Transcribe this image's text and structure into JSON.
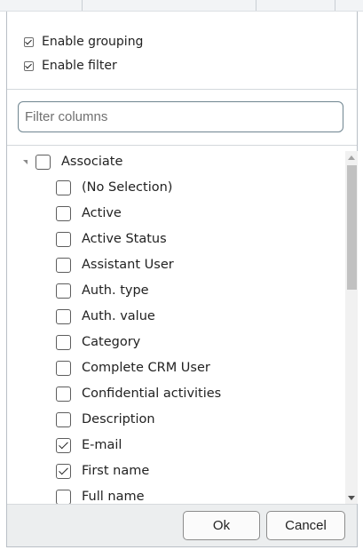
{
  "options": {
    "enable_grouping": {
      "label": "Enable grouping",
      "checked": true
    },
    "enable_filter": {
      "label": "Enable filter",
      "checked": true
    }
  },
  "filter": {
    "placeholder": "Filter columns",
    "value": ""
  },
  "tree": {
    "root": {
      "label": "Associate",
      "checked": false,
      "expanded": true
    },
    "items": [
      {
        "label": "(No Selection)",
        "checked": false
      },
      {
        "label": "Active",
        "checked": false
      },
      {
        "label": "Active Status",
        "checked": false
      },
      {
        "label": "Assistant User",
        "checked": false
      },
      {
        "label": "Auth. type",
        "checked": false
      },
      {
        "label": "Auth. value",
        "checked": false
      },
      {
        "label": "Category",
        "checked": false
      },
      {
        "label": "Complete CRM User",
        "checked": false
      },
      {
        "label": "Confidential activities",
        "checked": false
      },
      {
        "label": "Description",
        "checked": false
      },
      {
        "label": "E-mail",
        "checked": true
      },
      {
        "label": "First name",
        "checked": true
      },
      {
        "label": "Full name",
        "checked": false
      }
    ]
  },
  "footer": {
    "ok_label": "Ok",
    "cancel_label": "Cancel"
  }
}
